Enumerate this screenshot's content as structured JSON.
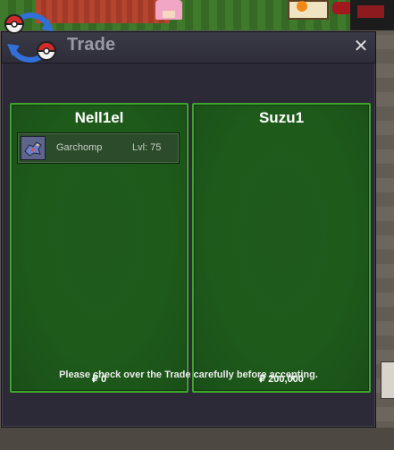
{
  "window": {
    "title": "Trade",
    "close_icon": "close-icon"
  },
  "trade": {
    "left": {
      "owner": "Nell1el",
      "money": "₽ 0",
      "items": [
        {
          "icon": "garchomp-sprite-icon",
          "name": "Garchomp",
          "level": "Lvl: 75"
        }
      ]
    },
    "right": {
      "owner": "Suzu1",
      "money": "₽ 200,000",
      "items": []
    }
  },
  "notice": "Please check over the Trade carefully before accepting.",
  "colors": {
    "panel_bg": "#1e5b1b",
    "panel_border": "#3da42c",
    "window_bg": "#2c2a37",
    "title_text": "#9a9aa6"
  }
}
